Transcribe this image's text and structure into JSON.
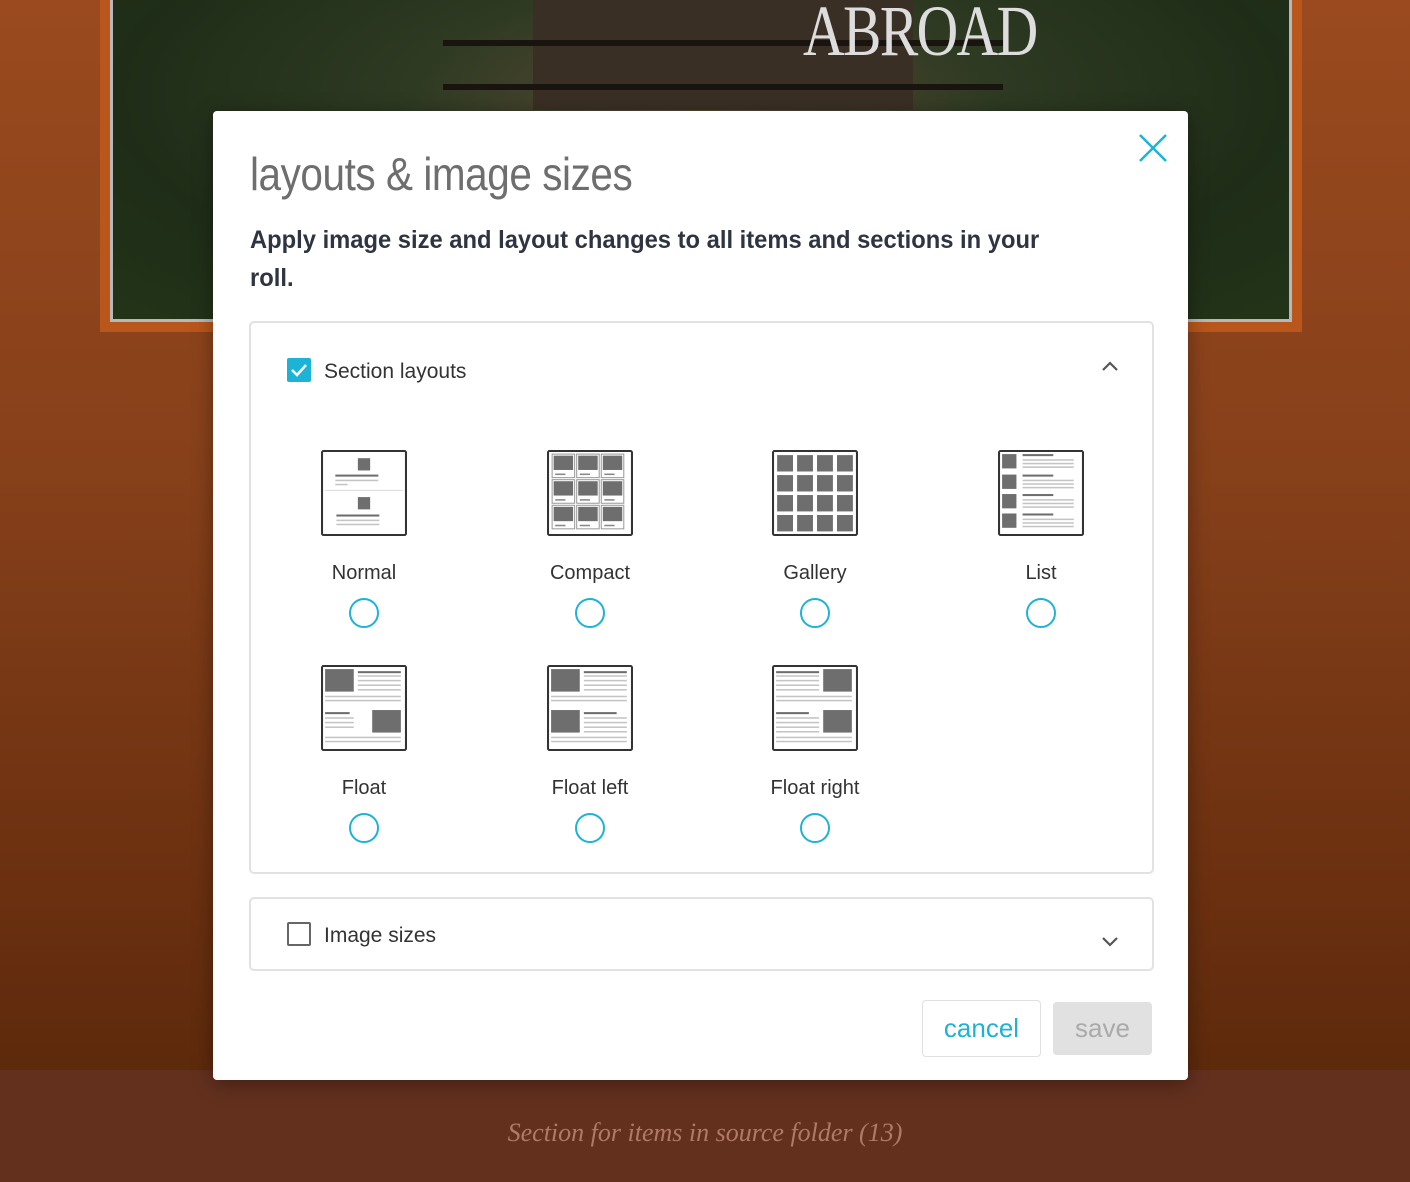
{
  "background": {
    "cover_logo_text": "ABROAD",
    "footer_text": "Section for items in source folder (13)"
  },
  "modal": {
    "title": "layouts & image sizes",
    "subtitle": "Apply image size and layout changes to all items and sections in your roll.",
    "accent_color": "#1cb3d6",
    "section_layouts": {
      "label": "Section layouts",
      "checked": true,
      "expanded": true,
      "options": [
        {
          "id": "normal",
          "label": "Normal",
          "selected": false
        },
        {
          "id": "compact",
          "label": "Compact",
          "selected": false
        },
        {
          "id": "gallery",
          "label": "Gallery",
          "selected": false
        },
        {
          "id": "list",
          "label": "List",
          "selected": false
        },
        {
          "id": "float",
          "label": "Float",
          "selected": false
        },
        {
          "id": "float-left",
          "label": "Float left",
          "selected": false
        },
        {
          "id": "float-right",
          "label": "Float right",
          "selected": false
        }
      ]
    },
    "image_sizes": {
      "label": "Image sizes",
      "checked": false,
      "expanded": false
    },
    "buttons": {
      "cancel": "cancel",
      "save": "save"
    }
  }
}
